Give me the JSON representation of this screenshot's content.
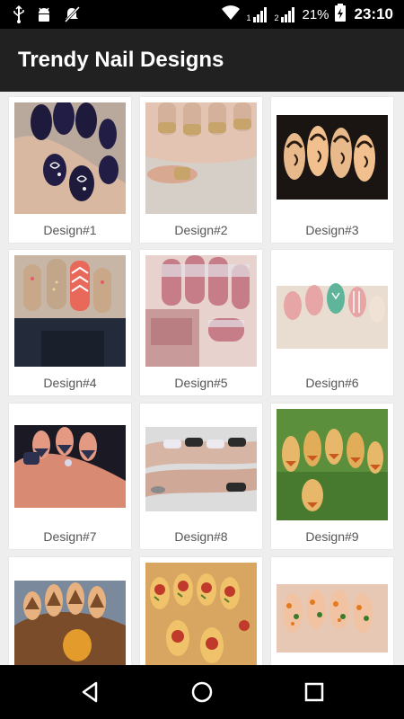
{
  "status_bar": {
    "icons_left": [
      "usb-icon",
      "android-debug-icon",
      "notification-muted-icon"
    ],
    "sim1_label": "1",
    "sim2_label": "2",
    "battery_percent": "21%",
    "time": "23:10"
  },
  "app_bar": {
    "title": "Trendy Nail Designs"
  },
  "designs": [
    {
      "label": "Design#1"
    },
    {
      "label": "Design#2"
    },
    {
      "label": "Design#3"
    },
    {
      "label": "Design#4"
    },
    {
      "label": "Design#5"
    },
    {
      "label": "Design#6"
    },
    {
      "label": "Design#7"
    },
    {
      "label": "Design#8"
    },
    {
      "label": "Design#9"
    },
    {
      "label": ""
    },
    {
      "label": ""
    },
    {
      "label": ""
    }
  ],
  "nav_bar": {
    "icons": [
      "back-icon",
      "home-icon",
      "recents-icon"
    ]
  },
  "colors": {
    "status_bar": "#000000",
    "app_bar": "#212121",
    "background": "#eeeeee",
    "label_text": "#555555"
  }
}
